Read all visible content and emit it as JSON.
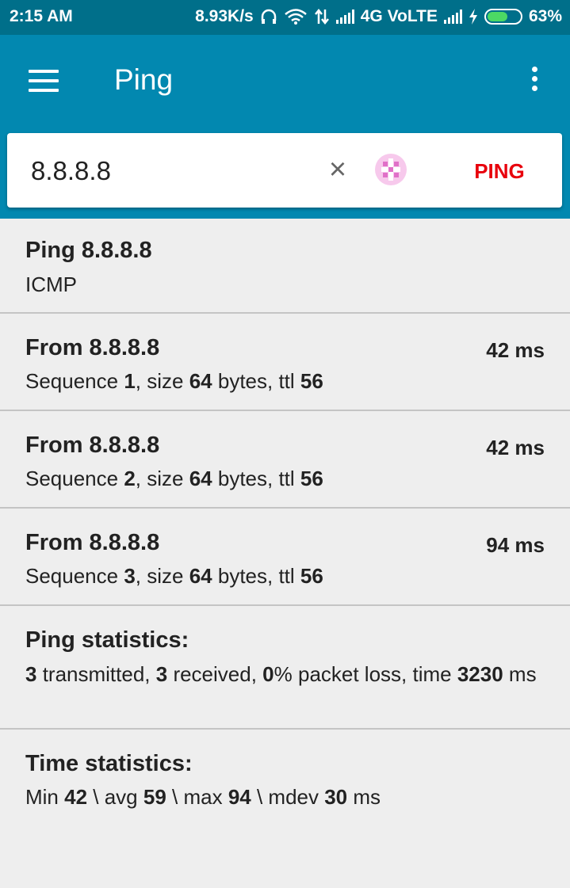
{
  "status_bar": {
    "time": "2:15 AM",
    "speed": "8.93K/s",
    "network": "4G VoLTE",
    "battery": "63%",
    "battery_level": 0.63
  },
  "app_bar": {
    "title": "Ping",
    "menu_icon": "hamburger-menu-icon",
    "more_icon": "more-vert-icon"
  },
  "search": {
    "value": "8.8.8.8",
    "clear_icon": "close-icon",
    "random_icon": "dice-icon",
    "ping_label": "PING",
    "ping_color": "#e8000c"
  },
  "header": {
    "title": "Ping 8.8.8.8",
    "protocol": "ICMP"
  },
  "replies": [
    {
      "from": "From 8.8.8.8",
      "time": "42 ms",
      "seq": "1",
      "size": "64",
      "ttl": "56"
    },
    {
      "from": "From 8.8.8.8",
      "time": "42 ms",
      "seq": "2",
      "size": "64",
      "ttl": "56"
    },
    {
      "from": "From 8.8.8.8",
      "time": "94 ms",
      "seq": "3",
      "size": "64",
      "ttl": "56"
    }
  ],
  "labels": {
    "sequence": "Sequence ",
    "size": ", size ",
    "bytes_ttl": " bytes, ttl "
  },
  "ping_stats": {
    "title": "Ping statistics:",
    "transmitted": "3",
    "transmitted_label": " transmitted, ",
    "received": "3",
    "received_label": " received, ",
    "loss": "0",
    "loss_label": "% packet loss, time ",
    "time": "3230",
    "time_unit": "ms"
  },
  "time_stats": {
    "title": "Time statistics:",
    "min_label": "Min ",
    "min": "42",
    "avg_label": " \\ avg ",
    "avg": "59",
    "max_label": " \\ max ",
    "max": "94",
    "mdev_label": " \\ mdev ",
    "mdev": "30",
    "unit": " ms"
  },
  "colors": {
    "status_bar": "#006f8a",
    "app_bar": "#0288b0",
    "background": "#eeeeee"
  }
}
